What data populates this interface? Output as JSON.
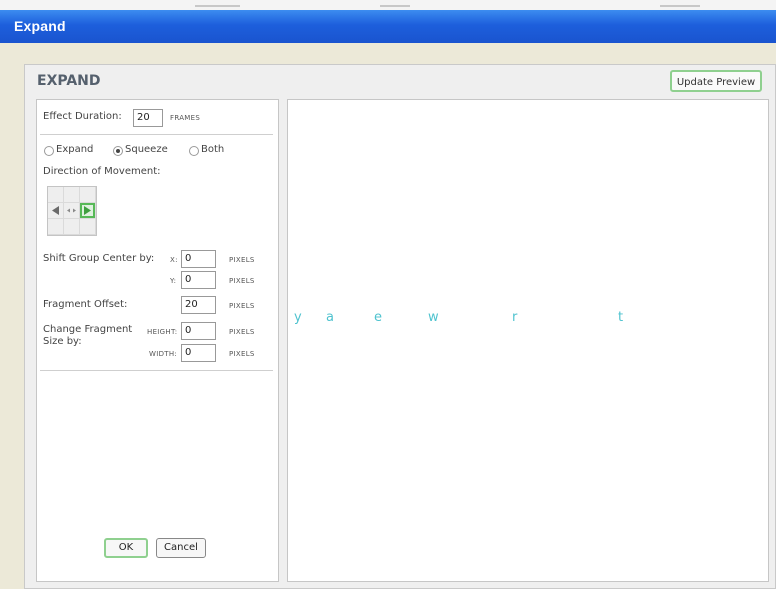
{
  "window": {
    "title": "Expand"
  },
  "panel": {
    "title": "EXPAND",
    "update_preview": "Update Preview"
  },
  "effect_duration": {
    "label": "Effect Duration:",
    "value": "20",
    "unit": "FRAMES"
  },
  "mode": {
    "options": [
      "Expand",
      "Squeeze",
      "Both"
    ],
    "selected": "Squeeze"
  },
  "direction": {
    "label": "Direction of Movement:",
    "selected": "right"
  },
  "shift_group": {
    "label": "Shift Group Center by:",
    "x_label": "X:",
    "x_value": "0",
    "y_label": "Y:",
    "y_value": "0",
    "unit": "PIXELS"
  },
  "fragment_offset": {
    "label": "Fragment Offset:",
    "value": "20",
    "unit": "PIXELS"
  },
  "fragment_size": {
    "label_line1": "Change Fragment",
    "label_line2": "Size by:",
    "height_label": "HEIGHT:",
    "height_value": "0",
    "width_label": "WIDTH:",
    "width_value": "0",
    "unit": "PIXELS"
  },
  "buttons": {
    "ok": "OK",
    "cancel": "Cancel"
  },
  "preview": {
    "letters": [
      "y",
      "a",
      "e",
      "w",
      "r",
      "t"
    ],
    "letter_color": "#4fc3cf"
  }
}
